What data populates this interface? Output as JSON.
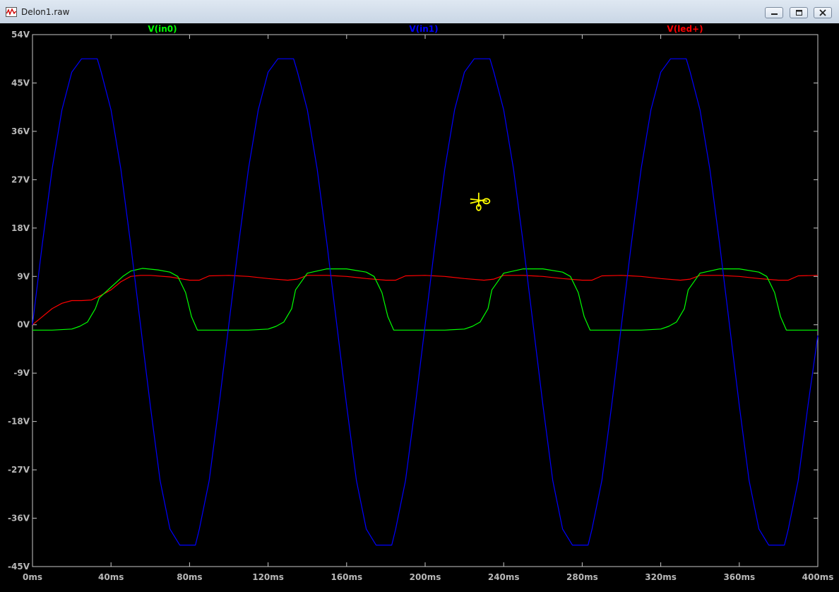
{
  "window": {
    "title": "Delon1.raw",
    "icons": [
      "waveform-icon",
      "minimize-icon",
      "restore-icon",
      "close-icon"
    ]
  },
  "chart_data": {
    "type": "line",
    "xlabel": "",
    "ylabel": "",
    "xlim": [
      0,
      400
    ],
    "ylim": [
      -45,
      54
    ],
    "x_ticks": [
      0,
      40,
      80,
      120,
      160,
      200,
      240,
      280,
      320,
      360,
      400
    ],
    "x_tick_labels": [
      "0ms",
      "40ms",
      "80ms",
      "120ms",
      "160ms",
      "200ms",
      "240ms",
      "280ms",
      "320ms",
      "360ms",
      "400ms"
    ],
    "y_ticks": [
      54,
      45,
      36,
      27,
      18,
      9,
      0,
      -9,
      -18,
      -27,
      -36,
      -45
    ],
    "y_tick_labels": [
      "54V",
      "45V",
      "36V",
      "27V",
      "18V",
      "9V",
      "0V",
      "-9V",
      "-18V",
      "-27V",
      "-36V",
      "-45V"
    ],
    "grid": false,
    "background": "#000000",
    "series": [
      {
        "name": "V(in0)",
        "color": "#00ff00",
        "x": [
          0,
          10,
          20,
          24,
          28,
          32,
          34,
          40,
          46,
          50,
          56,
          64,
          70,
          74,
          78,
          81,
          84,
          90,
          100,
          110,
          120,
          124,
          128,
          132,
          134,
          140,
          150,
          160,
          170,
          174,
          178,
          181,
          184,
          190,
          200,
          210,
          220,
          224,
          228,
          232,
          234,
          240,
          250,
          260,
          270,
          274,
          278,
          281,
          284,
          290,
          300,
          310,
          320,
          324,
          328,
          332,
          334,
          340,
          350,
          360,
          370,
          374,
          378,
          381,
          384,
          390,
          400
        ],
        "values": [
          -1,
          -1,
          -0.8,
          -0.3,
          0.5,
          3,
          5,
          7,
          9,
          10,
          10.5,
          10.2,
          9.8,
          9,
          6,
          1.5,
          -1,
          -1,
          -1,
          -1,
          -0.8,
          -0.3,
          0.5,
          3,
          6.5,
          9.6,
          10.4,
          10.4,
          9.8,
          9,
          6,
          1.5,
          -1,
          -1,
          -1,
          -1,
          -0.8,
          -0.3,
          0.5,
          3,
          6.5,
          9.6,
          10.4,
          10.4,
          9.8,
          9,
          6,
          1.5,
          -1,
          -1,
          -1,
          -1,
          -0.8,
          -0.3,
          0.5,
          3,
          6.5,
          9.6,
          10.4,
          10.4,
          9.8,
          9,
          6,
          1.5,
          -1,
          -1,
          -1
        ]
      },
      {
        "name": "V(in1)",
        "color": "#0000ff",
        "x": [
          0,
          5,
          10,
          15,
          20,
          25,
          28,
          33,
          35,
          40,
          45,
          50,
          55,
          60,
          65,
          70,
          75,
          78,
          83,
          85,
          90,
          95,
          100,
          105,
          110,
          115,
          120,
          125,
          128,
          133,
          135,
          140,
          145,
          150,
          155,
          160,
          165,
          170,
          175,
          178,
          183,
          185,
          190,
          195,
          200,
          205,
          210,
          215,
          220,
          225,
          228,
          233,
          235,
          240,
          245,
          250,
          255,
          260,
          265,
          270,
          275,
          278,
          283,
          285,
          290,
          295,
          300,
          305,
          310,
          315,
          320,
          325,
          328,
          333,
          335,
          340,
          345,
          350,
          355,
          360,
          365,
          370,
          375,
          378,
          383,
          385,
          390,
          395,
          400
        ],
        "values": [
          0,
          15,
          29,
          40,
          47,
          49.5,
          49.5,
          49.5,
          47,
          40,
          29,
          15,
          0,
          -15,
          -29,
          -38,
          -41,
          -41,
          -41,
          -38,
          -29,
          -15,
          0,
          15,
          29,
          40,
          47,
          49.5,
          49.5,
          49.5,
          47,
          40,
          29,
          15,
          0,
          -15,
          -29,
          -38,
          -41,
          -41,
          -41,
          -38,
          -29,
          -15,
          0,
          15,
          29,
          40,
          47,
          49.5,
          49.5,
          49.5,
          47,
          40,
          29,
          15,
          0,
          -15,
          -29,
          -38,
          -41,
          -41,
          -41,
          -38,
          -29,
          -15,
          0,
          15,
          29,
          40,
          47,
          49.5,
          49.5,
          49.5,
          47,
          40,
          29,
          15,
          0,
          -15,
          -29,
          -38,
          -41,
          -41,
          -41,
          -38,
          -29,
          -15,
          -2
        ]
      },
      {
        "name": "V(led+)",
        "color": "#ff0000",
        "x": [
          0,
          5,
          10,
          15,
          20,
          25,
          30,
          35,
          40,
          45,
          50,
          55,
          60,
          70,
          80,
          85,
          90,
          100,
          110,
          120,
          130,
          135,
          140,
          150,
          160,
          170,
          180,
          185,
          190,
          200,
          210,
          220,
          230,
          235,
          240,
          250,
          260,
          270,
          280,
          285,
          290,
          300,
          310,
          320,
          330,
          335,
          340,
          350,
          360,
          370,
          380,
          385,
          390,
          400
        ],
        "values": [
          0,
          1.5,
          3,
          4,
          4.5,
          4.5,
          4.6,
          5.5,
          6.5,
          8,
          9,
          9.2,
          9.2,
          8.9,
          8.3,
          8.3,
          9.1,
          9.2,
          9,
          8.6,
          8.3,
          8.5,
          9.2,
          9.2,
          9,
          8.6,
          8.3,
          8.3,
          9.1,
          9.2,
          9,
          8.6,
          8.3,
          8.5,
          9.2,
          9.2,
          9,
          8.6,
          8.3,
          8.3,
          9.1,
          9.2,
          9,
          8.6,
          8.3,
          8.5,
          9.2,
          9.2,
          9,
          8.6,
          8.3,
          8.3,
          9.1,
          9.2
        ]
      }
    ],
    "cursor": {
      "type": "scissors-icon",
      "color": "#ffff00",
      "x": 228,
      "y": 23
    }
  }
}
